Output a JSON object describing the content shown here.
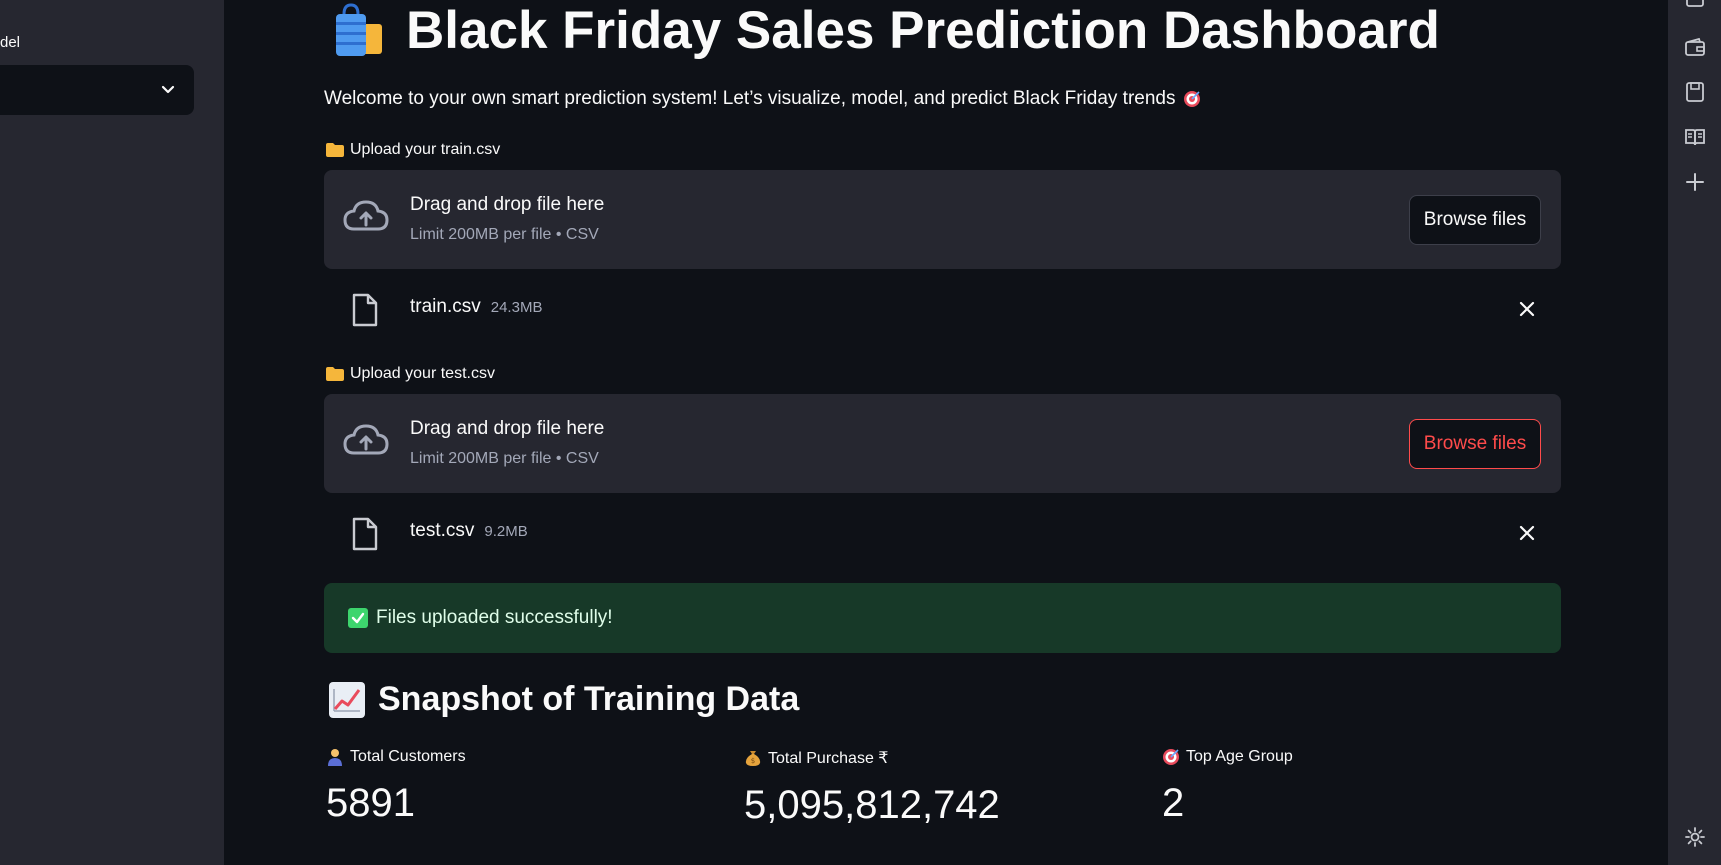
{
  "sidebar": {
    "label": "del"
  },
  "header": {
    "title": "Black Friday Sales Prediction Dashboard",
    "title_icon": "shopping-bags-icon",
    "intro": "Welcome to your own smart prediction system! Let’s visualize, model, and predict Black Friday trends"
  },
  "uploads": [
    {
      "label": "Upload your train.csv",
      "drop_title": "Drag and drop file here",
      "drop_sub": "Limit 200MB per file • CSV",
      "browse_label": "Browse files",
      "file_name": "train.csv",
      "file_size": "24.3MB"
    },
    {
      "label": "Upload your test.csv",
      "drop_title": "Drag and drop file here",
      "drop_sub": "Limit 200MB per file • CSV",
      "browse_label": "Browse files",
      "file_name": "test.csv",
      "file_size": "9.2MB"
    }
  ],
  "success_message": "Files uploaded successfully!",
  "snapshot": {
    "title": "Snapshot of Training Data",
    "metrics": [
      {
        "label": "Total Customers",
        "value": "5891",
        "icon": "person-icon"
      },
      {
        "label": "Total Purchase ₹",
        "value": "5,095,812,742",
        "icon": "money-bag-icon"
      },
      {
        "label": "Top Age Group",
        "value": "2",
        "icon": "target-icon"
      }
    ]
  },
  "colors": {
    "background": "#0e1117",
    "panel": "#262730",
    "accent": "#ff4b4b",
    "success_bg": "#173928",
    "success_check": "#3dd56d"
  }
}
